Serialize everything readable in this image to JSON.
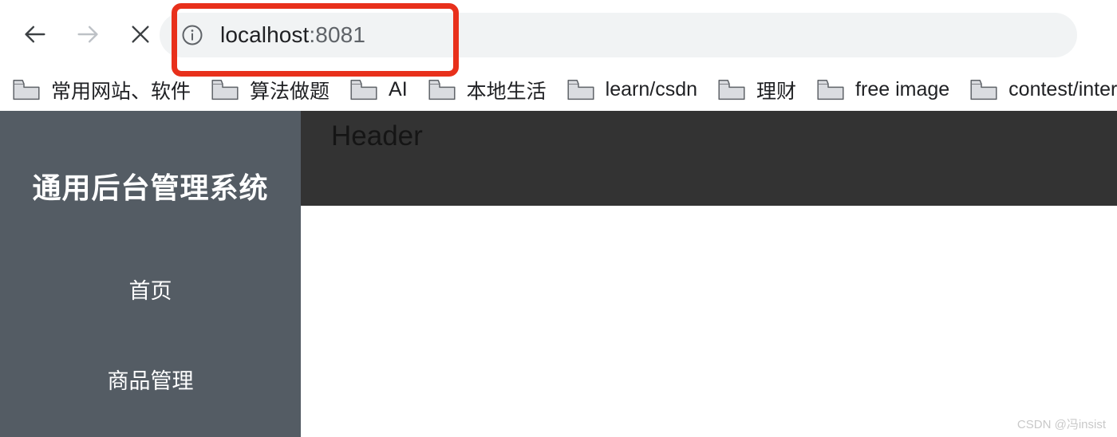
{
  "browser": {
    "nav": {
      "back_icon": "arrow-left-icon",
      "forward_icon": "arrow-right-icon",
      "stop_icon": "close-x-icon"
    },
    "omnibox": {
      "site_info_icon": "info-circle-icon",
      "url_host": "localhost",
      "url_port": ":8081",
      "full_url": "localhost:8081"
    },
    "bookmarks": [
      {
        "icon": "folder-icon",
        "label": "常用网站、软件"
      },
      {
        "icon": "folder-icon",
        "label": "算法做题"
      },
      {
        "icon": "folder-icon",
        "label": "AI"
      },
      {
        "icon": "folder-icon",
        "label": "本地生活"
      },
      {
        "icon": "folder-icon",
        "label": "learn/csdn"
      },
      {
        "icon": "folder-icon",
        "label": "理财"
      },
      {
        "icon": "folder-icon",
        "label": "free image"
      },
      {
        "icon": "folder-icon",
        "label": "contest/intervie"
      }
    ]
  },
  "annotation": {
    "shape": "rectangle",
    "color": "#e8301b",
    "target": "omnibox"
  },
  "app": {
    "sidebar": {
      "title": "通用后台管理系统",
      "background_color": "#545c64",
      "items": [
        {
          "label": "首页"
        },
        {
          "label": "商品管理"
        }
      ]
    },
    "header": {
      "title": "Header",
      "background_color": "#333333"
    },
    "main": {
      "background_color": "#ffffff",
      "content": ""
    }
  },
  "watermark": {
    "text": "CSDN @冯insist"
  }
}
